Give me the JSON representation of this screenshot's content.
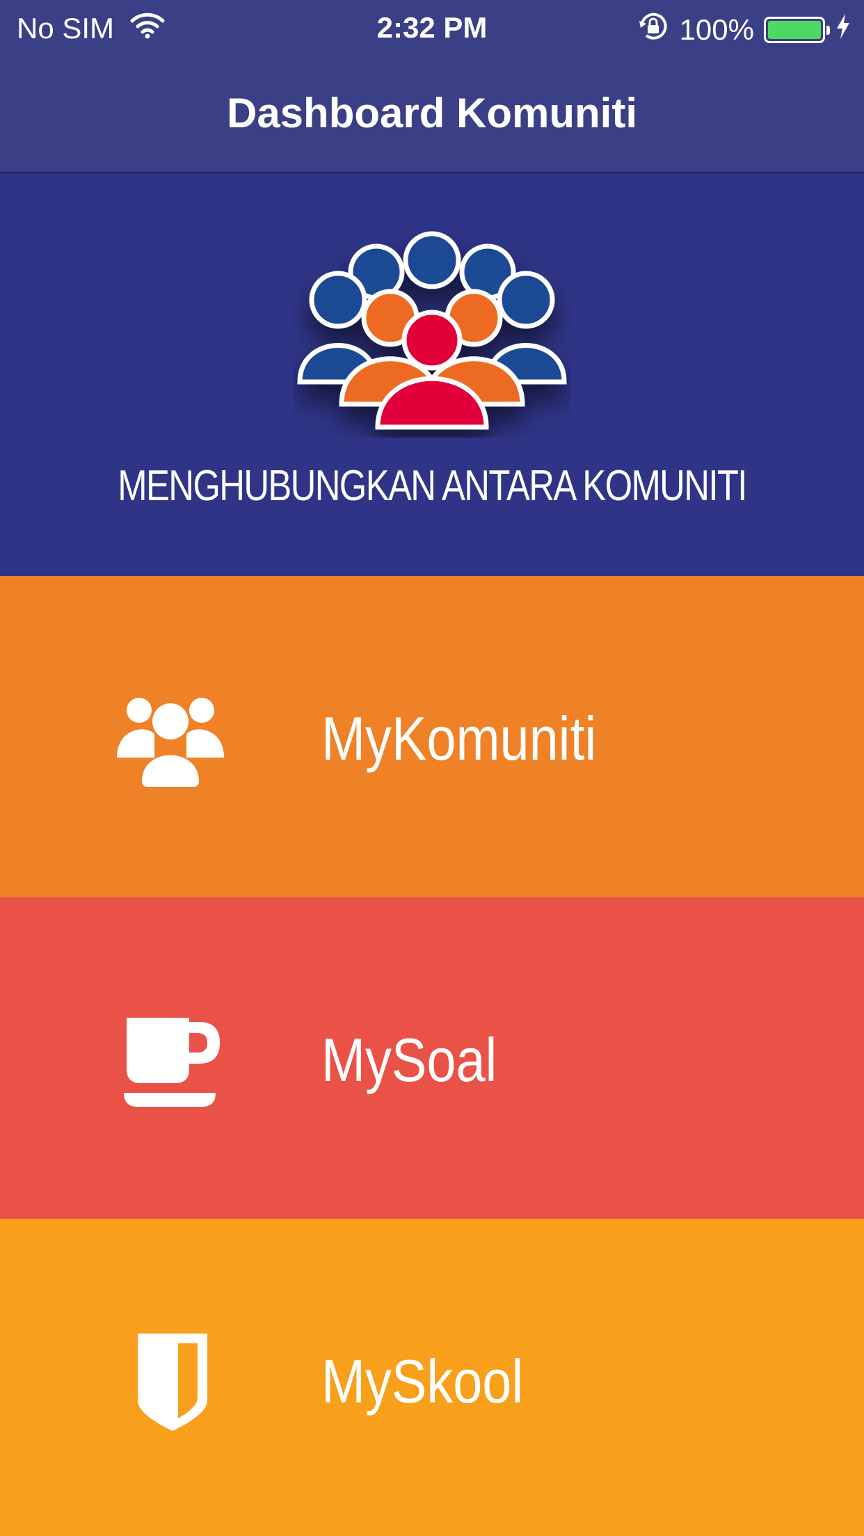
{
  "status_bar": {
    "carrier": "No SIM",
    "time": "2:32 PM",
    "battery_percent": "100%",
    "battery_level": 1.0
  },
  "nav": {
    "title": "Dashboard Komuniti"
  },
  "hero": {
    "tagline": "MENGHUBUNGKAN ANTARA KOMUNITI",
    "icon": "community-logo-icon"
  },
  "menu": [
    {
      "label": "MyKomuniti",
      "icon": "users-group-icon",
      "color": "#ef8127"
    },
    {
      "label": "MySoal",
      "icon": "coffee-cup-icon",
      "color": "#ea5247"
    },
    {
      "label": "MySkool",
      "icon": "shield-icon",
      "color": "#f8a01b"
    }
  ],
  "colors": {
    "nav_bg": "#3b3f85",
    "hero_bg": "#2f3486",
    "battery": "#4cd964"
  }
}
